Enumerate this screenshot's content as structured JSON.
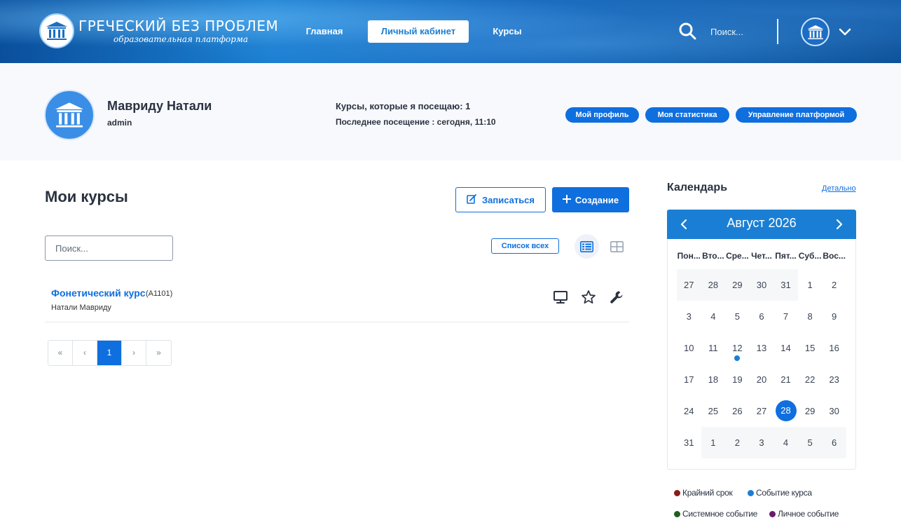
{
  "header": {
    "logo_title": "ГРЕЧЕСКИЙ БЕЗ ПРОБЛЕМ",
    "logo_subtitle": "образовательная платформа",
    "nav": {
      "home": "Главная",
      "cabinet": "Личный кабинет",
      "courses": "Курсы"
    },
    "search_placeholder": "Поиск...",
    "icons": [
      "logo-icon",
      "search-icon",
      "avatar",
      "chevron-down-icon"
    ]
  },
  "profile": {
    "name": "Мавриду Натали",
    "role": "admin",
    "courses_attending": "Курсы, которые я посещаю:  1",
    "last_visit": "Последнее посещение : сегодня, 11:10",
    "buttons": {
      "my_profile": "Мой профиль",
      "my_stats": "Моя статистика",
      "platform_management": "Управление платформой"
    }
  },
  "main": {
    "title": "Мои курсы",
    "enroll_label": "Записаться",
    "create_label": "Создание",
    "search_placeholder": "Поиск...",
    "list_all_label": "Список всех",
    "courses": [
      {
        "name": "Фонетический курс",
        "code": "(A1101)",
        "teacher": "Натали Мавриду"
      }
    ],
    "pagination": {
      "first": "«",
      "prev": "‹",
      "current": "1",
      "next": "›",
      "last": "»"
    }
  },
  "calendar": {
    "title": "Календарь",
    "detail_link": "Детально",
    "month_label": "Август 2026",
    "weekdays": [
      "Пон...",
      "Вто...",
      "Сре...",
      "Чет...",
      "Пят...",
      "Суб...",
      "Вос..."
    ],
    "weeks": [
      [
        "27",
        "28",
        "29",
        "30",
        "31",
        "1",
        "2"
      ],
      [
        "3",
        "4",
        "5",
        "6",
        "7",
        "8",
        "9"
      ],
      [
        "10",
        "11",
        "12",
        "13",
        "14",
        "15",
        "16"
      ],
      [
        "17",
        "18",
        "19",
        "20",
        "21",
        "22",
        "23"
      ],
      [
        "24",
        "25",
        "26",
        "27",
        "28",
        "29",
        "30"
      ],
      [
        "31",
        "1",
        "2",
        "3",
        "4",
        "5",
        "6"
      ]
    ],
    "today": "28",
    "course_event_day": "12",
    "legend": {
      "deadline": "Крайний срок",
      "course_event": "Событие курса",
      "system_event": "Системное событие",
      "personal_event": "Личное событие"
    },
    "colors": {
      "deadline": "#8b1a1a",
      "course_event": "#1a7fd4",
      "system_event": "#1f5e1f",
      "personal_event": "#6a1a6e",
      "accent": "#0f6fde"
    }
  }
}
